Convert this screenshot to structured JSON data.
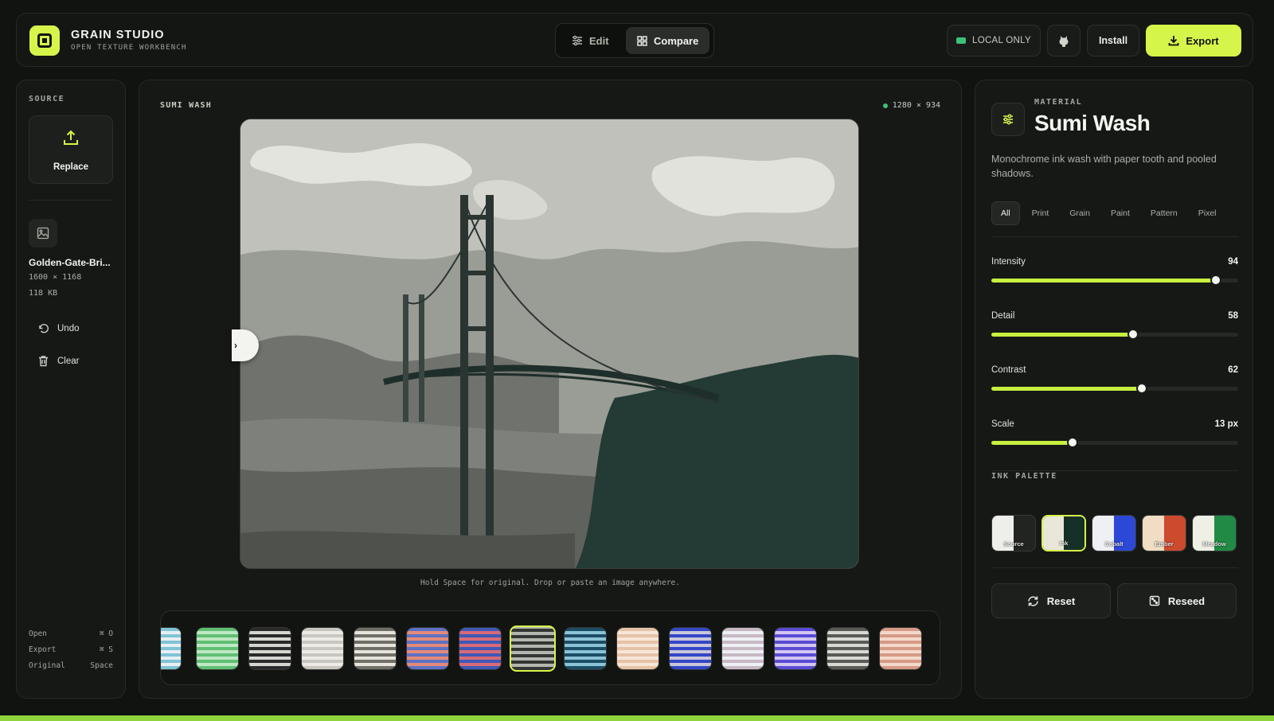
{
  "header": {
    "brand_title": "GRAIN STUDIO",
    "brand_subtitle": "OPEN TEXTURE WORKBENCH",
    "tabs": [
      {
        "label": "Edit"
      },
      {
        "label": "Compare"
      }
    ],
    "active_tab": "Compare",
    "local_label": "LOCAL ONLY",
    "install_label": "Install",
    "export_label": "Export"
  },
  "sidebar": {
    "section_label": "SOURCE",
    "replace_label": "Replace",
    "file_name": "Golden-Gate-Bri...",
    "file_dims": "1600 × 1168",
    "file_size": "118 KB",
    "undo_label": "Undo",
    "clear_label": "Clear",
    "shortcuts": [
      {
        "label": "Open",
        "key": "⌘ O"
      },
      {
        "label": "Export",
        "key": "⌘ S"
      },
      {
        "label": "Original",
        "key": "Space"
      }
    ]
  },
  "canvas": {
    "title": "SUMI WASH",
    "dims": "1280 × 934",
    "hint": "Hold Space for original. Drop or paste an image anywhere.",
    "compare_handle": "›"
  },
  "swatches": [
    {
      "name": "swatch-1",
      "a": "#7fc3d6",
      "b": "#e7f0f2"
    },
    {
      "name": "swatch-2",
      "a": "#5fbf73",
      "b": "#bfe8c4"
    },
    {
      "name": "swatch-3",
      "a": "#2a2a2a",
      "b": "#d6d6d0"
    },
    {
      "name": "swatch-4",
      "a": "#c9c6bf",
      "b": "#ecebe6"
    },
    {
      "name": "swatch-5",
      "a": "#6f6f66",
      "b": "#e6e4dc"
    },
    {
      "name": "swatch-6",
      "a": "#5e71c2",
      "b": "#e28a7a"
    },
    {
      "name": "swatch-7",
      "a": "#3f58b6",
      "b": "#d86a78"
    },
    {
      "name": "swatch-8",
      "a": "#333632",
      "b": "#b4b6b0"
    },
    {
      "name": "swatch-9",
      "a": "#1c4d66",
      "b": "#8bc3d7"
    },
    {
      "name": "swatch-10",
      "a": "#e6c2a6",
      "b": "#f6e6d8"
    },
    {
      "name": "swatch-11",
      "a": "#3347c7",
      "b": "#c9c6da"
    },
    {
      "name": "swatch-12",
      "a": "#c7b9c4",
      "b": "#eef0f4"
    },
    {
      "name": "swatch-13",
      "a": "#5a4ad4",
      "b": "#d3c6f2"
    },
    {
      "name": "swatch-14",
      "a": "#5a5a56",
      "b": "#d9d9d3"
    },
    {
      "name": "swatch-15",
      "a": "#d69a86",
      "b": "#f3d9cb"
    }
  ],
  "selected_swatch": 7,
  "material": {
    "label": "MATERIAL",
    "name": "Sumi Wash",
    "description": "Monochrome ink wash with paper tooth and pooled shadows.",
    "filters": [
      "All",
      "Print",
      "Grain",
      "Paint",
      "Pattern",
      "Pixel"
    ],
    "active_filter": "All",
    "sliders": [
      {
        "name": "Intensity",
        "value": "94",
        "fraction": 0.91
      },
      {
        "name": "Detail",
        "value": "58",
        "fraction": 0.575
      },
      {
        "name": "Contrast",
        "value": "62",
        "fraction": 0.61
      },
      {
        "name": "Scale",
        "value": "13 px",
        "fraction": 0.33
      }
    ],
    "palette_label": "INK PALETTE",
    "palettes": [
      {
        "name": "Source",
        "a": "#eeeeea",
        "b": "#222422"
      },
      {
        "name": "Ink",
        "a": "#e9e6da",
        "b": "#173027"
      },
      {
        "name": "Cobalt",
        "a": "#eef0f4",
        "b": "#2c48d6"
      },
      {
        "name": "Ember",
        "a": "#f1dcc4",
        "b": "#cc4a2e"
      },
      {
        "name": "Meadow",
        "a": "#eef0e6",
        "b": "#218a45"
      }
    ],
    "selected_palette": 1,
    "reset_label": "Reset",
    "reseed_label": "Reseed"
  },
  "colors": {
    "accent": "#d6f54a",
    "status": "#3fc07a"
  }
}
